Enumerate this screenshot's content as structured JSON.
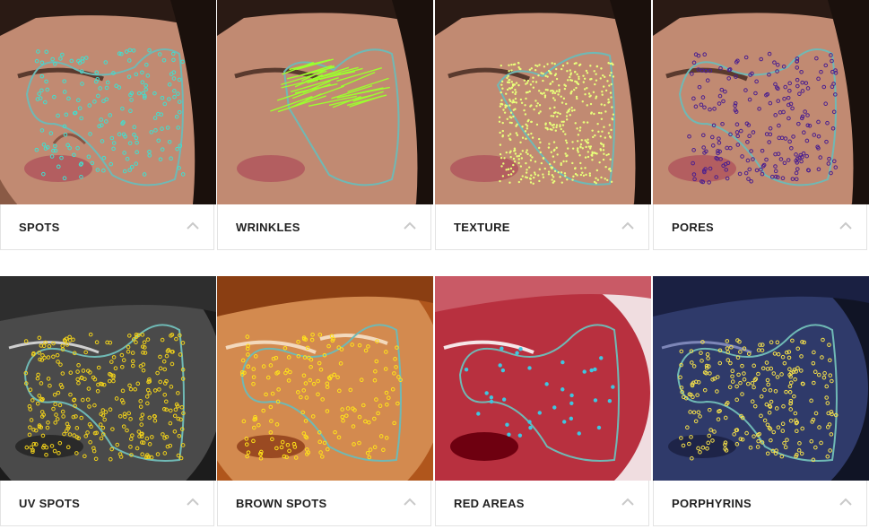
{
  "panels": [
    {
      "label": "SPOTS",
      "image": "face-spots-analysis"
    },
    {
      "label": "WRINKLES",
      "image": "face-wrinkles-analysis"
    },
    {
      "label": "TEXTURE",
      "image": "face-texture-analysis"
    },
    {
      "label": "PORES",
      "image": "face-pores-analysis"
    },
    {
      "label": "UV SPOTS",
      "image": "face-uv-spots-analysis"
    },
    {
      "label": "BROWN SPOTS",
      "image": "face-brown-spots-analysis"
    },
    {
      "label": "RED AREAS",
      "image": "face-red-areas-analysis"
    },
    {
      "label": "PORPHYRINS",
      "image": "face-porphyrins-analysis"
    }
  ],
  "icons": {
    "expand": "chevron-up-icon"
  },
  "colors": {
    "spots_marks": "#3fe0d0",
    "wrinkles_marks": "#9cff2e",
    "texture_marks": "#e8ff7a",
    "pores_marks": "#4b1f8f",
    "uv_marks": "#f2d21a",
    "brown_marks": "#ffe21a",
    "red_marks": "#3fc6e0",
    "porphyrin_marks": "#f5e04a",
    "outline": "#6fb9b5"
  }
}
